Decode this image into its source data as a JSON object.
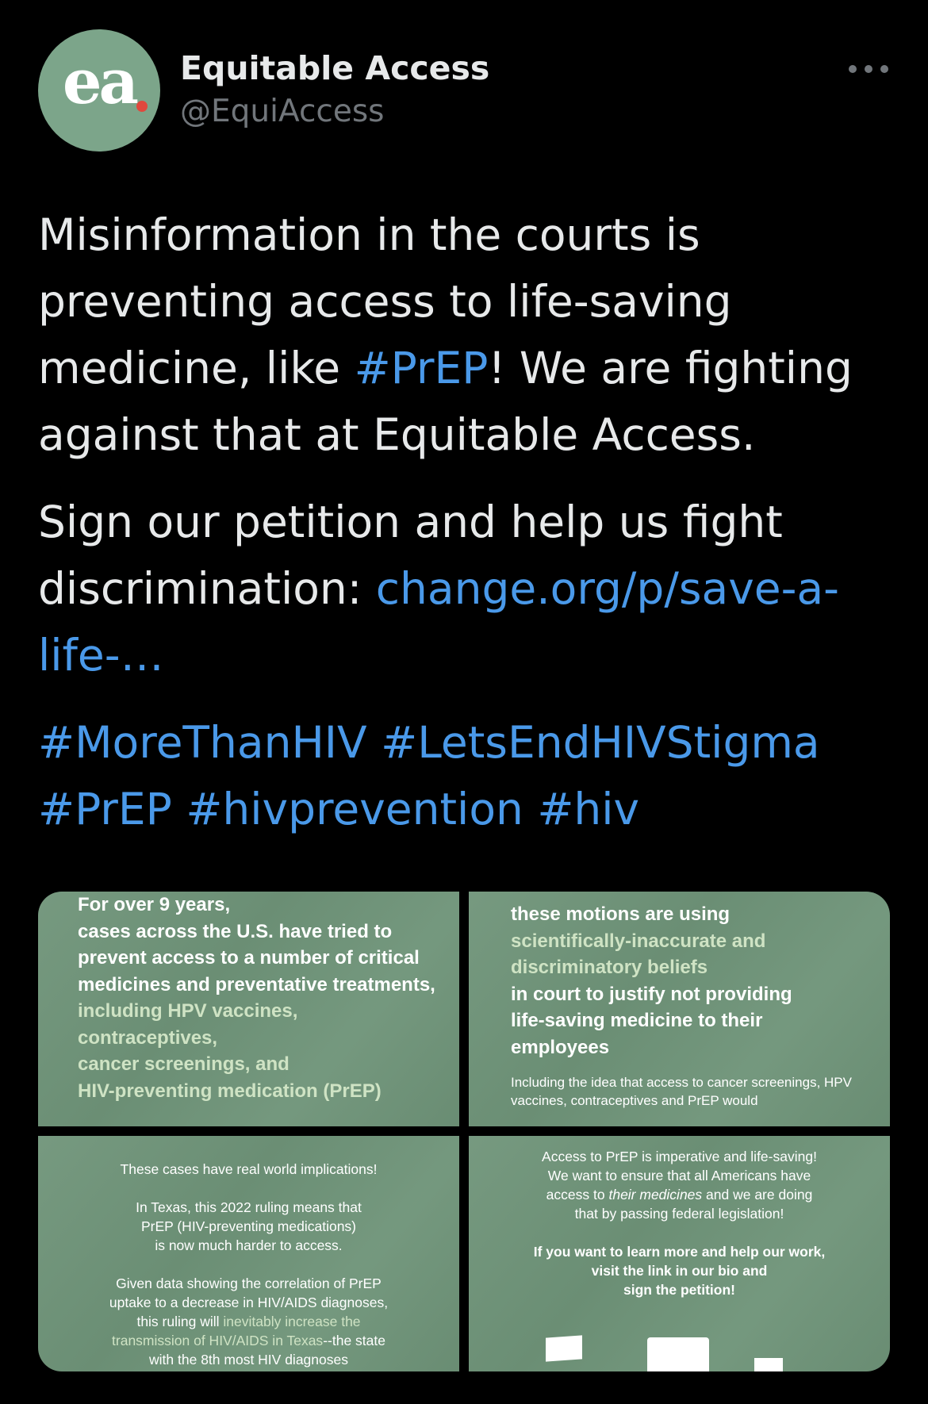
{
  "author": {
    "avatar_text": "ea",
    "name": "Equitable Access",
    "handle": "@EquiAccess"
  },
  "colors": {
    "link": "#4a99e9",
    "avatar_bg": "#7ca58a",
    "avatar_dot": "#e0483d",
    "media_bg": "#6f9479"
  },
  "more_icon": "more-horizontal-icon",
  "tweet": {
    "p1_a": "Misinformation in the courts is preventing access to life-saving medicine, like ",
    "p1_tag": "#PrEP",
    "p1_b": "! We are fighting against that at Equitable Access.",
    "p2_a": "Sign our petition and help us fight discrimination: ",
    "p2_link": "change.org/p/save-a-life-…",
    "hashtags": [
      "#MoreThanHIV",
      "#LetsEndHIVStigma",
      "#PrEP",
      "#hivprevention",
      "#hiv"
    ]
  },
  "media": {
    "tile1": {
      "l1": "For over 9 years,",
      "l2": "cases  across the U.S. have tried to prevent access to a number of critical medicines and preventative treatments,",
      "l3": " including HPV vaccines,",
      "l4": "contraceptives,",
      "l5": "cancer screenings, and",
      "l6": "HIV-preventing medication (PrEP)"
    },
    "tile2": {
      "l1": "these motions are using",
      "l2": "scientifically-inaccurate and",
      "l3": "discriminatory beliefs",
      "l4": "in court to justify not providing",
      "l5": "life-saving medicine to their",
      "l6": "employees",
      "small": "Including the idea that access to cancer screenings, HPV vaccines, contraceptives and PrEP would"
    },
    "tile3": {
      "l1": "These cases have real world implications!",
      "l2": "In Texas, this 2022 ruling means that",
      "l3": "PrEP (HIV-preventing medications)",
      "l4": "is now much harder to access.",
      "l5": "Given data showing the correlation of PrEP",
      "l6": "uptake to a decrease in HIV/AIDS diagnoses,",
      "l7a": "this ruling will ",
      "l7b": "inevitably increase the",
      "l8a": "transmission of HIV/AIDS in Texas",
      "l8b": "--the state",
      "l9": "with the 8th most HIV diagnoses"
    },
    "tile4": {
      "l1": "Access to PrEP is imperative and life-saving!",
      "l2": "We want to ensure that all Americans have",
      "l3a": "access to ",
      "l3b": "their medicines",
      "l3c": " and we are doing",
      "l4": "that by passing federal legislation!",
      "l5": "If you want to learn more and help our work,",
      "l6": "visit  the link in our bio and",
      "l7": "sign the petition!"
    }
  }
}
